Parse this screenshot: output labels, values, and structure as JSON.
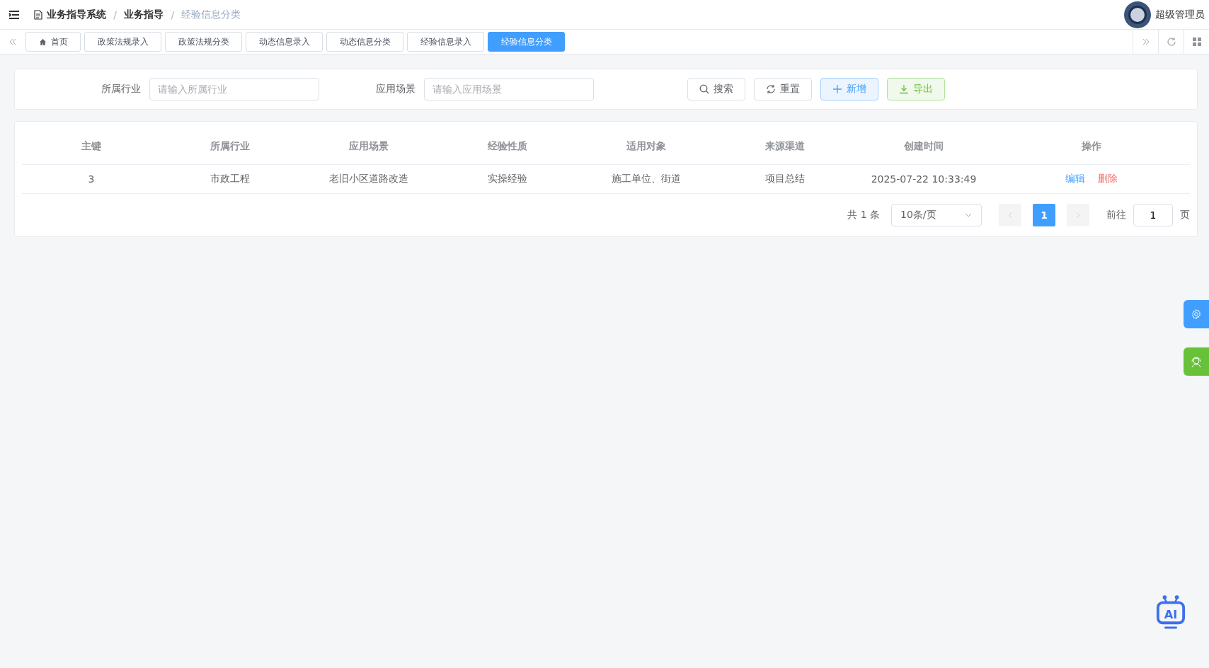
{
  "breadcrumb": [
    {
      "label": "业务指导系统",
      "current": false
    },
    {
      "label": "业务指导",
      "current": false,
      "separator": "/"
    },
    {
      "label": "经验信息分类",
      "current": true,
      "separator": "/"
    }
  ],
  "user": {
    "name": "超级管理员"
  },
  "tabs": [
    {
      "label": "首页",
      "kind": "home",
      "selected": false
    },
    {
      "label": "政策法规录入",
      "kind": "page",
      "selected": false
    },
    {
      "label": "政策法规分类",
      "kind": "page",
      "selected": false
    },
    {
      "label": "动态信息录入",
      "kind": "page",
      "selected": false
    },
    {
      "label": "动态信息分类",
      "kind": "page",
      "selected": false
    },
    {
      "label": "经验信息录入",
      "kind": "page",
      "selected": false
    },
    {
      "label": "经验信息分类",
      "kind": "page",
      "selected": true
    }
  ],
  "filters": [
    {
      "label": "所属行业",
      "placeholder": "请输入所属行业"
    },
    {
      "label": "应用场景",
      "placeholder": "请输入应用场景"
    }
  ],
  "actions": [
    {
      "label": "搜索",
      "kind": "search"
    },
    {
      "label": "重置",
      "kind": "reset"
    },
    {
      "label": "新增",
      "kind": "add"
    },
    {
      "label": "导出",
      "kind": "export"
    }
  ],
  "table": {
    "columns": [
      "主键",
      "所属行业",
      "应用场景",
      "经验性质",
      "适用对象",
      "来源渠道",
      "创建时间",
      "操作"
    ],
    "rows": [
      {
        "cells": [
          "3",
          "市政工程",
          "老旧小区道路改造",
          "实操经验",
          "施工单位、街道",
          "项目总结",
          "2025-07-22 10:33:49"
        ],
        "operations": [
          {
            "label": "编辑",
            "kind": "edit"
          },
          {
            "label": "删除",
            "kind": "delete"
          }
        ]
      }
    ]
  },
  "pagination": {
    "total": "共 1 条",
    "page_size": "10条/页",
    "pages": [
      {
        "label": "1",
        "selected": true
      }
    ],
    "goto_label": "前往",
    "goto_value": "1",
    "page_unit": "页"
  },
  "ai_assistant": {
    "label": "AI"
  }
}
